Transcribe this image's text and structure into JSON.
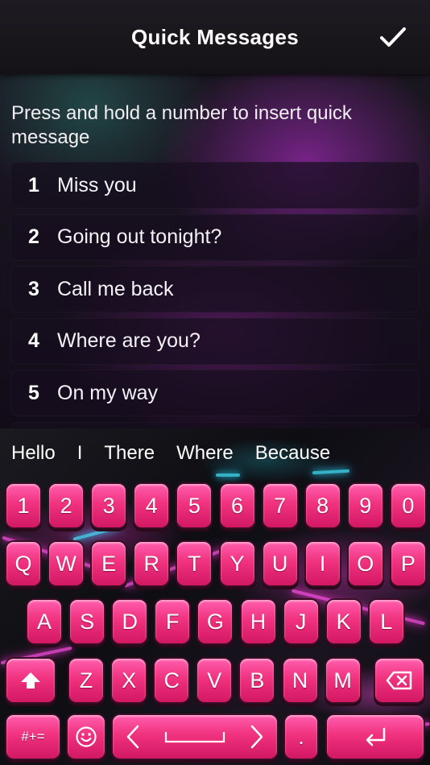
{
  "header": {
    "title": "Quick Messages",
    "confirm_icon": "checkmark-icon"
  },
  "instructions": "Press and hold a number to insert quick message",
  "messages": [
    {
      "num": "1",
      "text": "Miss you"
    },
    {
      "num": "2",
      "text": "Going out tonight?"
    },
    {
      "num": "3",
      "text": "Call me back"
    },
    {
      "num": "4",
      "text": "Where are you?"
    },
    {
      "num": "5",
      "text": "On my way"
    }
  ],
  "suggestions": [
    "Hello",
    "I",
    "There",
    "Where",
    "Because"
  ],
  "keyboard": {
    "row_numbers": [
      "1",
      "2",
      "3",
      "4",
      "5",
      "6",
      "7",
      "8",
      "9",
      "0"
    ],
    "row_top": [
      "Q",
      "W",
      "E",
      "R",
      "T",
      "Y",
      "U",
      "I",
      "O",
      "P"
    ],
    "row_middle": [
      "A",
      "S",
      "D",
      "F",
      "G",
      "H",
      "J",
      "K",
      "L"
    ],
    "row_bottom": [
      "Z",
      "X",
      "C",
      "V",
      "B",
      "N",
      "M"
    ],
    "symbols_label": "#+=",
    "period_label": ".",
    "shift_icon": "shift-arrow-icon",
    "backspace_icon": "backspace-icon",
    "emoji_icon": "smiley-icon",
    "space_icon": "space-bar-icon",
    "return_icon": "return-arrow-icon",
    "key_color": "#f0327f"
  }
}
